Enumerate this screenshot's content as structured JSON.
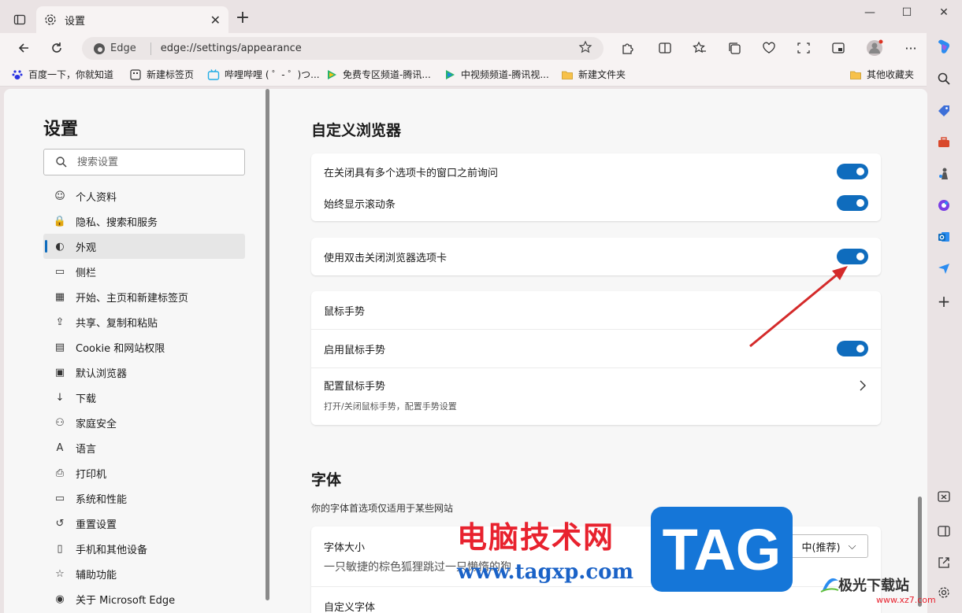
{
  "tab": {
    "title": "设置"
  },
  "address": {
    "site": "Edge",
    "url": "edge://settings/appearance"
  },
  "bookmarks": [
    "百度一下，你就知道",
    "新建标签页",
    "哔哩哔哩 ( ゜- ゜)つ...",
    "免费专区频道-腾讯...",
    "中视频频道-腾讯视...",
    "新建文件夹",
    "其他收藏夹"
  ],
  "settings": {
    "title": "设置",
    "search_placeholder": "搜索设置",
    "nav": [
      "个人资料",
      "隐私、搜索和服务",
      "外观",
      "侧栏",
      "开始、主页和新建标签页",
      "共享、复制和粘贴",
      "Cookie 和网站权限",
      "默认浏览器",
      "下载",
      "家庭安全",
      "语言",
      "打印机",
      "系统和性能",
      "重置设置",
      "手机和其他设备",
      "辅助功能",
      "关于 Microsoft Edge"
    ],
    "active_index": 2
  },
  "customize": {
    "title": "自定义浏览器",
    "ask_before_close": "在关闭具有多个选项卡的窗口之前询问",
    "always_scrollbar": "始终显示滚动条",
    "double_click_close": "使用双击关闭浏览器选项卡",
    "mouse_gesture_header": "鼠标手势",
    "enable_mouse_gesture": "启用鼠标手势",
    "configure_mouse_gesture": "配置鼠标手势",
    "configure_mouse_gesture_desc": "打开/关闭鼠标手势，配置手势设置"
  },
  "fonts": {
    "title": "字体",
    "desc": "你的字体首选项仅适用于某些网站",
    "font_size": "字体大小",
    "font_size_value": "中(推荐)",
    "preview": "一只敏捷的棕色狐狸跳过一只懒惰的狗",
    "custom_fonts": "自定义字体"
  },
  "watermark": {
    "cn": "电脑技术网",
    "url": "www.tagxp.com",
    "tag": "TAG",
    "site": "极光下载站",
    "site_url": "www.xz7.com"
  },
  "colors": {
    "accent": "#0f6cbd",
    "arrow": "#d42a2a"
  }
}
